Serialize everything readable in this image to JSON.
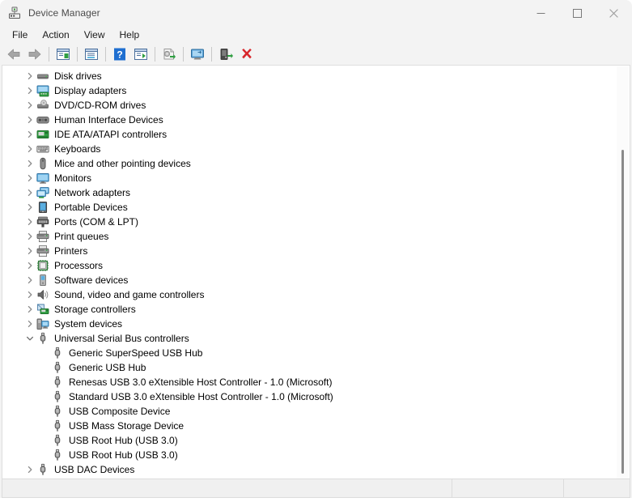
{
  "window": {
    "title": "Device Manager",
    "icon": "device-manager-icon",
    "controls": [
      {
        "name": "minimize",
        "glyph": "minimize-icon"
      },
      {
        "name": "maximize",
        "glyph": "maximize-icon"
      },
      {
        "name": "close",
        "glyph": "close-icon"
      }
    ]
  },
  "menubar": {
    "items": [
      {
        "label": "File"
      },
      {
        "label": "Action"
      },
      {
        "label": "View"
      },
      {
        "label": "Help"
      }
    ]
  },
  "toolbar": {
    "buttons": [
      {
        "name": "back-button",
        "icon": "back-arrow-icon"
      },
      {
        "name": "forward-button",
        "icon": "forward-arrow-icon"
      },
      {
        "name": "separator-1",
        "icon": "separator"
      },
      {
        "name": "show-hide-console-tree-button",
        "icon": "console-tree-icon"
      },
      {
        "name": "separator-2",
        "icon": "separator"
      },
      {
        "name": "properties-button",
        "icon": "properties-icon"
      },
      {
        "name": "separator-3",
        "icon": "separator"
      },
      {
        "name": "help-button",
        "icon": "help-question-icon"
      },
      {
        "name": "show-hide-action-pane-button",
        "icon": "action-pane-icon"
      },
      {
        "name": "separator-4",
        "icon": "separator"
      },
      {
        "name": "update-driver-button",
        "icon": "update-driver-icon"
      },
      {
        "name": "separator-5",
        "icon": "separator"
      },
      {
        "name": "scan-for-hardware-changes-button",
        "icon": "scan-hardware-icon"
      },
      {
        "name": "separator-6",
        "icon": "separator"
      },
      {
        "name": "enable-device-button",
        "icon": "enable-device-icon"
      },
      {
        "name": "uninstall-device-button",
        "icon": "red-x-icon"
      }
    ]
  },
  "tree": {
    "nodes": [
      {
        "label": "Disk drives",
        "icon": "disk-drive-icon",
        "depth": 0,
        "expanded": false,
        "has_children": true
      },
      {
        "label": "Display adapters",
        "icon": "display-adapter-icon",
        "depth": 0,
        "expanded": false,
        "has_children": true
      },
      {
        "label": "DVD/CD-ROM drives",
        "icon": "dvd-drive-icon",
        "depth": 0,
        "expanded": false,
        "has_children": true
      },
      {
        "label": "Human Interface Devices",
        "icon": "hid-icon",
        "depth": 0,
        "expanded": false,
        "has_children": true
      },
      {
        "label": "IDE ATA/ATAPI controllers",
        "icon": "ide-controller-icon",
        "depth": 0,
        "expanded": false,
        "has_children": true
      },
      {
        "label": "Keyboards",
        "icon": "keyboard-icon",
        "depth": 0,
        "expanded": false,
        "has_children": true
      },
      {
        "label": "Mice and other pointing devices",
        "icon": "mouse-icon",
        "depth": 0,
        "expanded": false,
        "has_children": true
      },
      {
        "label": "Monitors",
        "icon": "monitor-icon",
        "depth": 0,
        "expanded": false,
        "has_children": true
      },
      {
        "label": "Network adapters",
        "icon": "network-adapter-icon",
        "depth": 0,
        "expanded": false,
        "has_children": true
      },
      {
        "label": "Portable Devices",
        "icon": "portable-device-icon",
        "depth": 0,
        "expanded": false,
        "has_children": true
      },
      {
        "label": "Ports (COM & LPT)",
        "icon": "port-icon",
        "depth": 0,
        "expanded": false,
        "has_children": true
      },
      {
        "label": "Print queues",
        "icon": "printer-icon",
        "depth": 0,
        "expanded": false,
        "has_children": true
      },
      {
        "label": "Printers",
        "icon": "printer-icon",
        "depth": 0,
        "expanded": false,
        "has_children": true
      },
      {
        "label": "Processors",
        "icon": "processor-icon",
        "depth": 0,
        "expanded": false,
        "has_children": true
      },
      {
        "label": "Software devices",
        "icon": "software-device-icon",
        "depth": 0,
        "expanded": false,
        "has_children": true
      },
      {
        "label": "Sound, video and game controllers",
        "icon": "sound-device-icon",
        "depth": 0,
        "expanded": false,
        "has_children": true
      },
      {
        "label": "Storage controllers",
        "icon": "storage-controller-icon",
        "depth": 0,
        "expanded": false,
        "has_children": true
      },
      {
        "label": "System devices",
        "icon": "system-device-icon",
        "depth": 0,
        "expanded": false,
        "has_children": true
      },
      {
        "label": "Universal Serial Bus controllers",
        "icon": "usb-icon",
        "depth": 0,
        "expanded": true,
        "has_children": true
      },
      {
        "label": "Generic SuperSpeed USB Hub",
        "icon": "usb-icon",
        "depth": 1,
        "expanded": false,
        "has_children": false
      },
      {
        "label": "Generic USB Hub",
        "icon": "usb-icon",
        "depth": 1,
        "expanded": false,
        "has_children": false
      },
      {
        "label": "Renesas USB 3.0 eXtensible Host Controller - 1.0 (Microsoft)",
        "icon": "usb-icon",
        "depth": 1,
        "expanded": false,
        "has_children": false
      },
      {
        "label": "Standard USB 3.0 eXtensible Host Controller - 1.0 (Microsoft)",
        "icon": "usb-icon",
        "depth": 1,
        "expanded": false,
        "has_children": false
      },
      {
        "label": "USB Composite Device",
        "icon": "usb-icon",
        "depth": 1,
        "expanded": false,
        "has_children": false
      },
      {
        "label": "USB Mass Storage Device",
        "icon": "usb-icon",
        "depth": 1,
        "expanded": false,
        "has_children": false
      },
      {
        "label": "USB Root Hub (USB 3.0)",
        "icon": "usb-icon",
        "depth": 1,
        "expanded": false,
        "has_children": false
      },
      {
        "label": "USB Root Hub (USB 3.0)",
        "icon": "usb-icon",
        "depth": 1,
        "expanded": false,
        "has_children": false
      },
      {
        "label": "USB DAC Devices",
        "icon": "usb-icon",
        "depth": 0,
        "expanded": false,
        "has_children": true
      }
    ]
  },
  "statusbar": {
    "panes": [
      {
        "name": "status-pane-message",
        "text": ""
      },
      {
        "name": "status-pane-secondary",
        "text": ""
      },
      {
        "name": "status-pane-tertiary",
        "text": ""
      }
    ]
  },
  "colors": {
    "window_bg": "#f3f3f3",
    "panel_bg": "#ffffff",
    "text": "#000000",
    "title_text": "#4a4a4a",
    "chevron": "#8b8b8b",
    "scrollbar_thumb": "#8a8a8a",
    "accent_red": "#d8272c",
    "accent_green": "#1f9c3f",
    "accent_blue": "#1f6fd0"
  }
}
